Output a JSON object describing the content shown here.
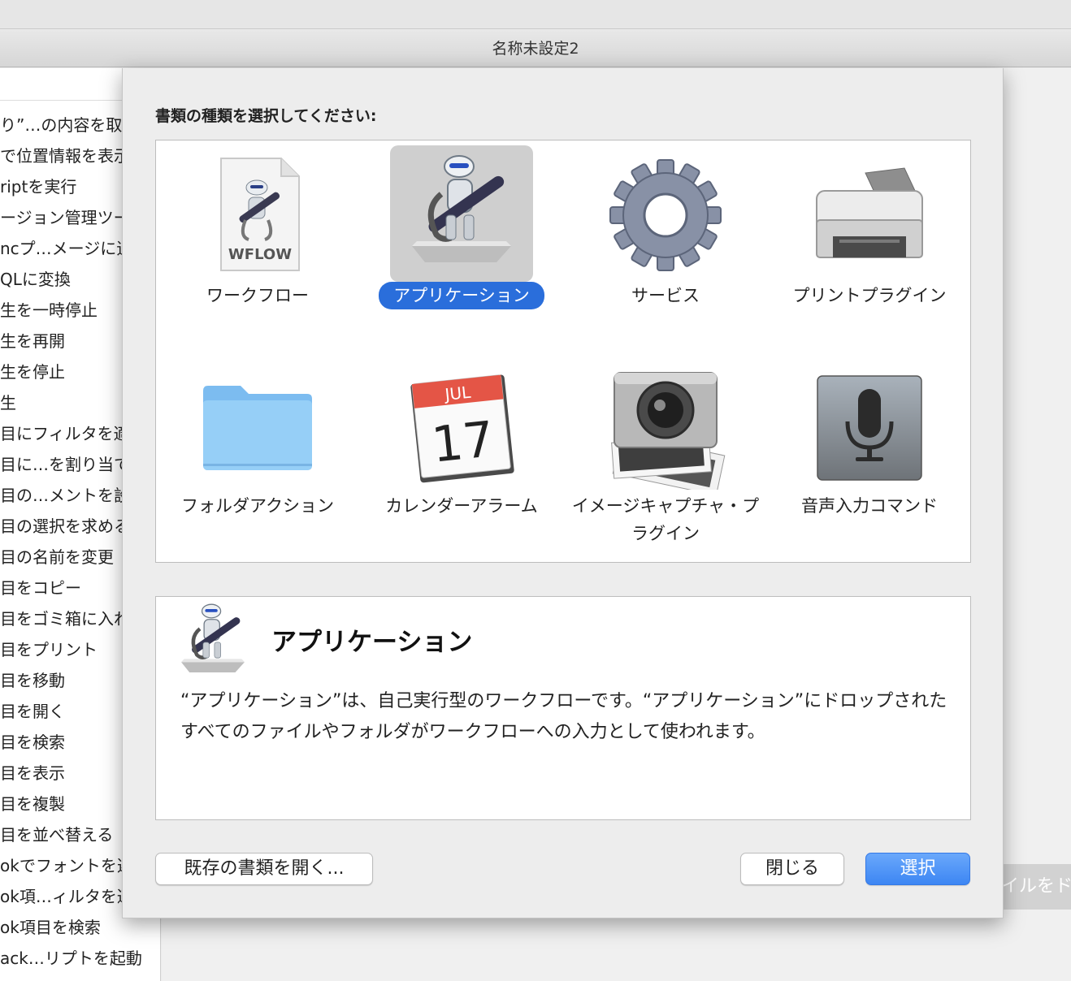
{
  "window": {
    "title": "名称未設定2"
  },
  "sidebar": {
    "items": [
      "り”…の内容を取",
      "で位置情報を表示",
      "riptを実行",
      "ージョン管理ツー",
      "ncプ…メージに追",
      "QLに変換",
      "生を一時停止",
      "生を再開",
      "生を停止",
      "生",
      "目にフィルタを適",
      "目に…を割り当て",
      "目の…メントを設",
      "目の選択を求める",
      "目の名前を変更",
      "目をコピー",
      "目をゴミ箱に入れ",
      "目をプリント",
      "目を移動",
      "目を開く",
      "目を検索",
      "目を表示",
      "目を複製",
      "目を並べ替える",
      "okでフォントを選",
      "ok項…ィルタを適",
      "ok項目を検索",
      "ack…リプトを起動"
    ]
  },
  "main": {
    "drop_hint": "イルをド"
  },
  "dialog": {
    "prompt": "書類の種類を選択してください:",
    "types": [
      {
        "label": "ワークフロー",
        "icon": "workflow-document-icon",
        "badge": "WFLOW"
      },
      {
        "label": "アプリケーション",
        "icon": "automator-robot-icon",
        "selected": true
      },
      {
        "label": "サービス",
        "icon": "gear-icon"
      },
      {
        "label": "プリントプラグイン",
        "icon": "printer-icon"
      },
      {
        "label": "フォルダアクション",
        "icon": "folder-icon"
      },
      {
        "label": "カレンダーアラーム",
        "icon": "calendar-icon",
        "month": "JUL",
        "day": "17"
      },
      {
        "label": "イメージキャプチャ・プラグイン",
        "icon": "camera-icon"
      },
      {
        "label": "音声入力コマンド",
        "icon": "microphone-icon"
      }
    ],
    "description": {
      "title": "アプリケーション",
      "text": "“アプリケーション”は、自己実行型のワークフローです。“アプリケーション”にドロップされたすべてのファイルやフォルダがワークフローへの入力として使われます。"
    },
    "buttons": {
      "open_existing": "既存の書類を開く...",
      "close": "閉じる",
      "choose": "選択"
    }
  },
  "colors": {
    "accent": "#2a6edb",
    "choose_button": "#3d86f3"
  }
}
